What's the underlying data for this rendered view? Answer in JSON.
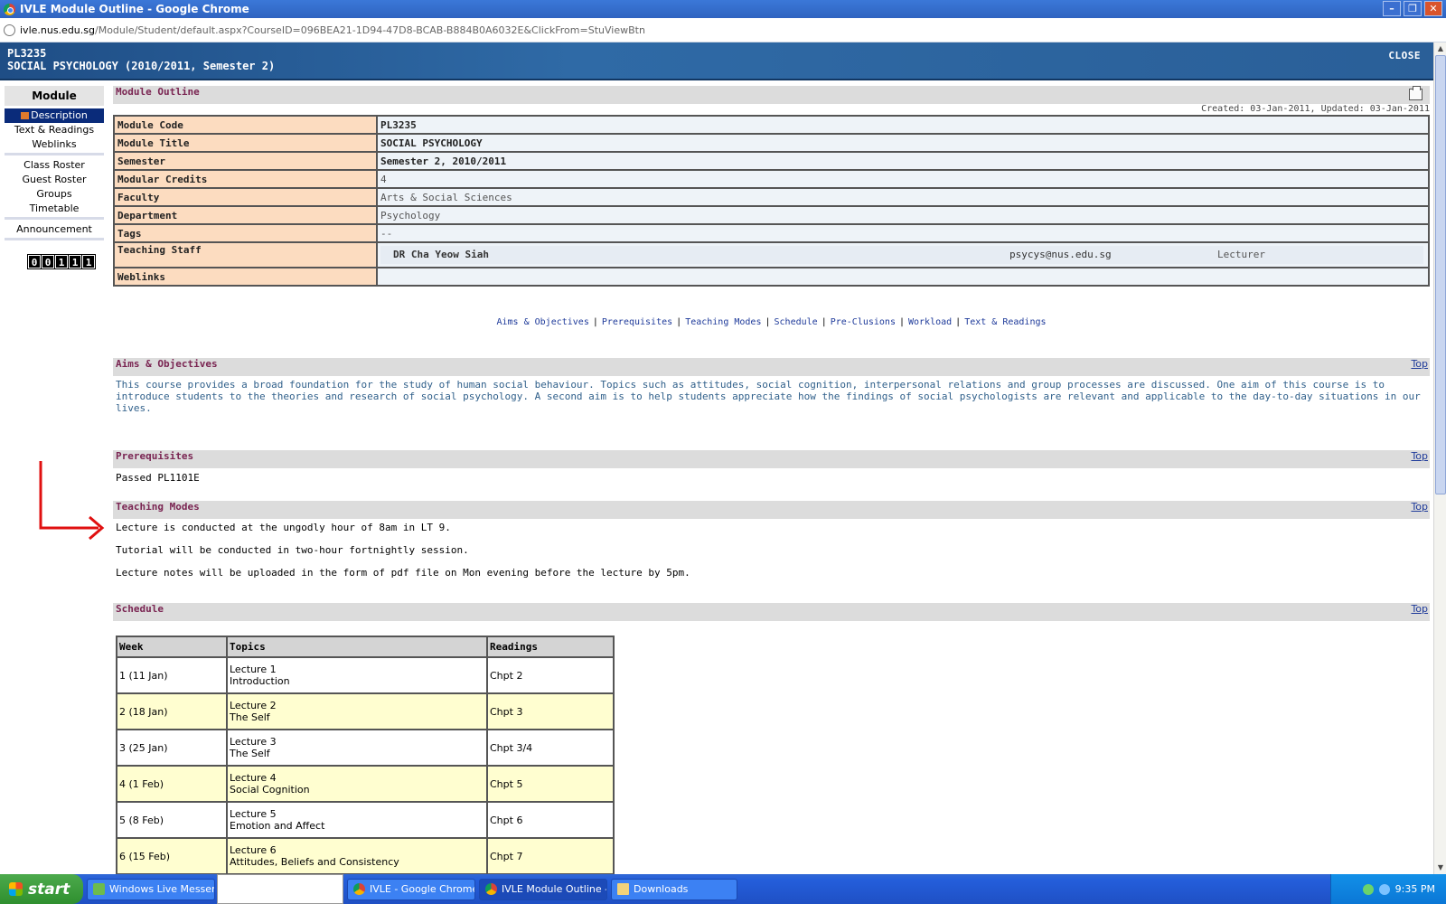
{
  "window": {
    "title": "IVLE Module Outline - Google Chrome",
    "buttons": [
      "–",
      "❐",
      "✕"
    ]
  },
  "address": {
    "host": "ivle.nus.edu.sg",
    "path": "/Module/Student/default.aspx?CourseID=096BEA21-1D94-47D8-BCAB-B884B0A6032E&ClickFrom=StuViewBtn"
  },
  "header": {
    "code": "PL3235",
    "title": "SOCIAL PSYCHOLOGY (2010/2011, Semester 2)",
    "close_label": "CLOSE"
  },
  "sidebar": {
    "heading": "Module",
    "groups": [
      [
        "Description",
        "Text & Readings",
        "Weblinks"
      ],
      [
        "Class Roster",
        "Guest Roster",
        "Groups",
        "Timetable"
      ],
      [
        "Announcement"
      ]
    ],
    "active": "Description",
    "counter": [
      "0",
      "0",
      "1",
      "1",
      "1"
    ]
  },
  "outline": {
    "heading": "Module Outline",
    "created": "Created: 03-Jan-2011, Updated: 03-Jan-2011",
    "rows": [
      {
        "label": "Module Code",
        "value": "PL3235",
        "bold": true
      },
      {
        "label": "Module Title",
        "value": "SOCIAL PSYCHOLOGY",
        "bold": true
      },
      {
        "label": "Semester",
        "value": "Semester 2, 2010/2011",
        "bold": true
      },
      {
        "label": "Modular Credits",
        "value": "4",
        "bold": false
      },
      {
        "label": "Faculty",
        "value": "Arts & Social Sciences",
        "bold": false
      },
      {
        "label": "Department",
        "value": "Psychology",
        "bold": false
      },
      {
        "label": "Tags",
        "value": "--",
        "bold": false
      }
    ],
    "staff_label": "Teaching Staff",
    "staff": {
      "name": "DR Cha Yeow Siah",
      "email": "psycys@nus.edu.sg",
      "role": "Lecturer"
    },
    "weblinks_label": "Weblinks"
  },
  "nav_links": [
    "Aims & Objectives",
    "Prerequisites",
    "Teaching Modes",
    "Schedule",
    "Pre-Clusions",
    "Workload",
    "Text & Readings"
  ],
  "top_label": "Top",
  "aims": {
    "heading": "Aims & Objectives",
    "text": "This course provides a broad foundation for the study of human social behaviour. Topics such as attitudes, social cognition, interpersonal relations and group processes are discussed. One aim of this course is to introduce students to the theories and research of social psychology. A second aim is to help students appreciate how the findings of social psychologists are relevant and applicable to the day-to-day situations in our lives."
  },
  "prereq": {
    "heading": "Prerequisites",
    "text": "Passed PL1101E"
  },
  "teaching": {
    "heading": "Teaching Modes",
    "lines": [
      "Lecture is conducted at the ungodly hour of 8am in LT 9.",
      "Tutorial will be conducted in two-hour fortnightly session.",
      "Lecture notes will be uploaded in the form of pdf file on Mon evening before the lecture by 5pm."
    ]
  },
  "schedule": {
    "heading": "Schedule",
    "columns": [
      "Week",
      "Topics",
      "Readings"
    ],
    "rows": [
      {
        "week": "1 (11 Jan)",
        "lecture": "Lecture 1",
        "topic": "Introduction",
        "reading": "Chpt 2"
      },
      {
        "week": "2 (18 Jan)",
        "lecture": "Lecture 2",
        "topic": "The Self",
        "reading": "Chpt 3"
      },
      {
        "week": "3 (25 Jan)",
        "lecture": "Lecture 3",
        "topic": "The Self",
        "reading": "Chpt 3/4"
      },
      {
        "week": "4 (1 Feb)",
        "lecture": "Lecture 4",
        "topic": "Social Cognition",
        "reading": "Chpt 5"
      },
      {
        "week": "5 (8 Feb)",
        "lecture": "Lecture 5",
        "topic": "Emotion and Affect",
        "reading": "Chpt 6"
      },
      {
        "week": "6 (15 Feb)",
        "lecture": "Lecture 6",
        "topic": "Attitudes, Beliefs and Consistency",
        "reading": "Chpt 7"
      }
    ]
  },
  "taskbar": {
    "start_label": "start",
    "tasks": [
      {
        "label": "Windows Live Messen...",
        "icon": "msn"
      },
      {
        "label": "IVLE - Google Chrome",
        "icon": "chrome"
      },
      {
        "label": "IVLE Module Outline -...",
        "icon": "chrome",
        "active": true
      },
      {
        "label": "Downloads",
        "icon": "folder"
      }
    ],
    "clock": "9:35 PM"
  },
  "colors": {
    "accent": "#7a2552",
    "link": "#1e3a9a",
    "label_bg": "#fcdcc0",
    "annotation": "#e01010"
  }
}
